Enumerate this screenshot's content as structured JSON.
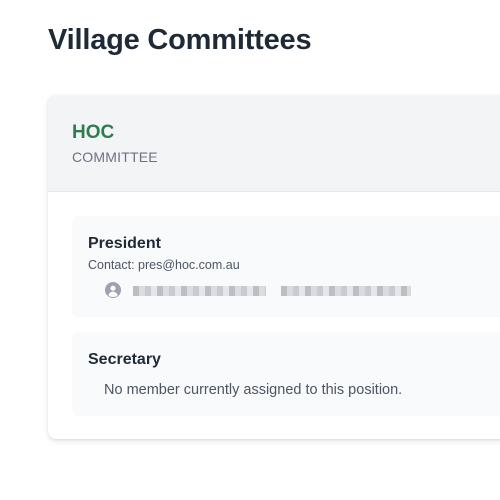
{
  "page": {
    "title": "Village Committees"
  },
  "committee": {
    "name": "HOC",
    "type_label": "COMMITTEE",
    "accent_color": "#2e7d4f",
    "positions": [
      {
        "title": "President",
        "contact": "Contact: pres@hoc.com.au",
        "member_icon": "user-circle-icon",
        "member_name": "",
        "member_name_redacted": true
      },
      {
        "title": "Secretary",
        "empty_message": "No member currently assigned to this position."
      }
    ]
  }
}
